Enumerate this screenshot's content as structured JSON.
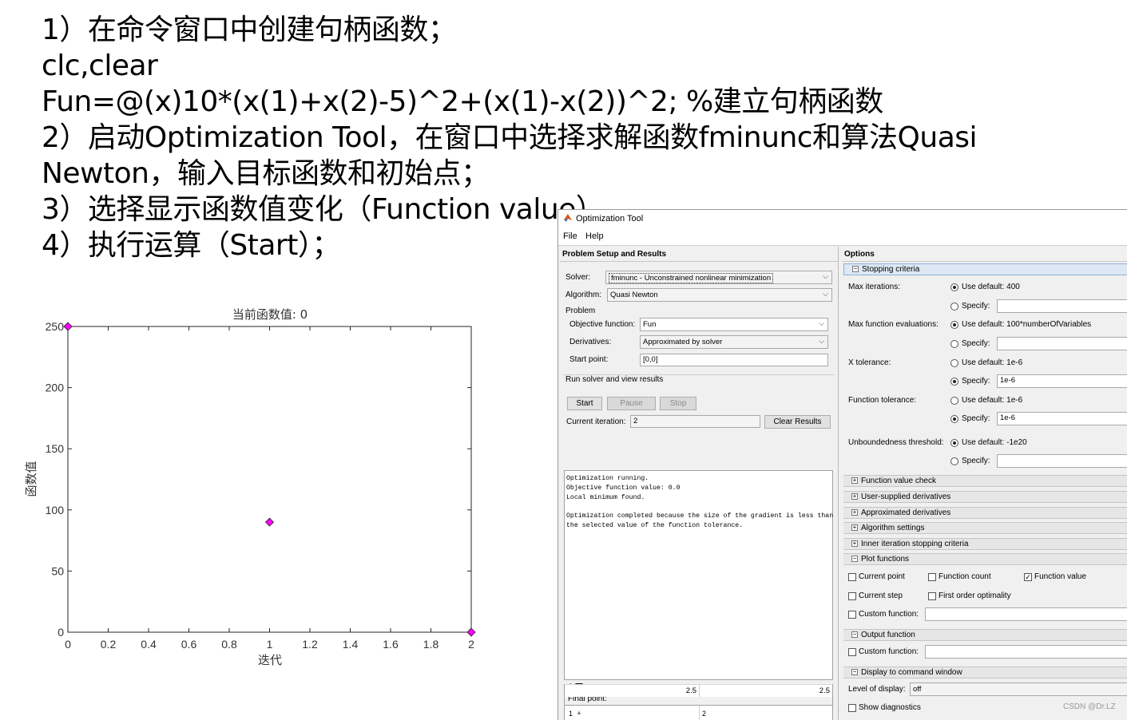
{
  "slide": {
    "lines": [
      "1）在命令窗口中创建句柄函数；",
      "clc,clear",
      "Fun=@(x)10*(x(1)+x(2)-5)^2+(x(1)-x(2))^2; %建立句柄函数",
      "2）启动Optimization Tool，在窗口中选择求解函数fminunc和算法Quasi",
      "Newton，输入目标函数和初始点；",
      "3）选择显示函数值变化（Function value）",
      "4）执行运算（Start）；"
    ]
  },
  "chart_data": {
    "type": "scatter",
    "title": "当前函数值: 0",
    "xlabel": "迭代",
    "ylabel": "函数值",
    "xlim": [
      0,
      2
    ],
    "ylim": [
      0,
      250
    ],
    "xticks": [
      "0",
      "0.2",
      "0.4",
      "0.6",
      "0.8",
      "1",
      "1.2",
      "1.4",
      "1.6",
      "1.8",
      "2"
    ],
    "yticks": [
      "0",
      "50",
      "100",
      "150",
      "200",
      "250"
    ],
    "marker_color": "#ff00ff",
    "marker": "diamond",
    "points": [
      {
        "x": 0,
        "y": 250
      },
      {
        "x": 1,
        "y": 90
      },
      {
        "x": 2,
        "y": 0
      }
    ]
  },
  "window": {
    "title": "Optimization Tool",
    "menu": [
      "File",
      "Help"
    ],
    "left": {
      "header": "Problem Setup and Results",
      "solver_label": "Solver:",
      "solver_value": "fminunc - Unconstrained nonlinear minimization",
      "algorithm_label": "Algorithm:",
      "algorithm_value": "Quasi Newton",
      "problem_label": "Problem",
      "objective_label": "Objective function:",
      "objective_value": "Fun",
      "derivatives_label": "Derivatives:",
      "derivatives_value": "Approximated by solver",
      "start_point_label": "Start point:",
      "start_point_value": "[0,0]",
      "run_label": "Run solver and view results",
      "start_button": "Start",
      "pause_button": "Pause",
      "stop_button": "Stop",
      "iteration_label": "Current iteration:",
      "iteration_value": "2",
      "clear_button": "Clear Results",
      "output_lines": [
        "Optimization running.",
        "Objective function value: 0.0",
        "Local minimum found.",
        "",
        "Optimization completed because the size of the gradient is less than",
        "the selected value of the function tolerance."
      ],
      "final_point_label": "Final point:",
      "final_col1": "1",
      "final_col2": "2",
      "final_val1": "2.5",
      "final_val2": "2.5"
    },
    "right": {
      "header": "Options",
      "stopping_criteria": "Stopping criteria",
      "max_iter_label": "Max iterations:",
      "max_iter_default": "Use default: 400",
      "specify": "Specify:",
      "max_fev_label": "Max function evaluations:",
      "max_fev_default": "Use default: 100*numberOfVariables",
      "xtol_label": "X tolerance:",
      "xtol_default": "Use default: 1e-6",
      "xtol_value": "1e-6",
      "ftol_label": "Function tolerance:",
      "ftol_default": "Use default: 1e-6",
      "ftol_value": "1e-6",
      "unb_label": "Unboundedness threshold:",
      "unb_default": "Use default: -1e20",
      "sections_collapsed": [
        "Function value check",
        "User-supplied derivatives",
        "Approximated derivatives",
        "Algorithm settings",
        "Inner iteration stopping criteria"
      ],
      "plot_functions": "Plot functions",
      "current_point": "Current point",
      "function_count": "Function count",
      "function_value": "Function value",
      "current_step": "Current step",
      "first_order": "First order optimality",
      "custom_function": "Custom function:",
      "output_function": "Output function",
      "display_section": "Display to command window",
      "level_label": "Level of display:",
      "level_value": "off",
      "show_diag": "Show diagnostics"
    }
  },
  "watermark": "CSDN @Dr.LZ"
}
